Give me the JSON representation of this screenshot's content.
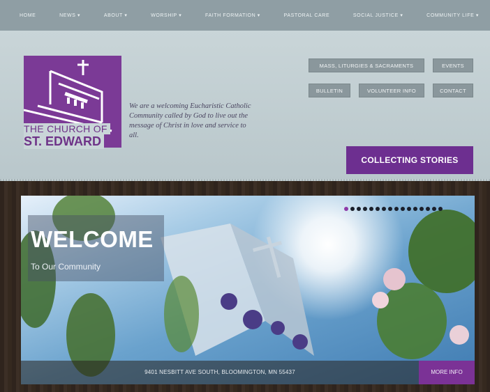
{
  "nav": {
    "items": [
      "HOME",
      "NEWS ▾",
      "ABOUT ▾",
      "WORSHIP ▾",
      "FAITH FORMATION ▾",
      "PASTORAL CARE",
      "SOCIAL JUSTICE ▾",
      "COMMUNITY LIFE ▾"
    ]
  },
  "logo": {
    "line1": "THE CHURCH OF",
    "line2": "ST. EDWARD"
  },
  "tagline": "We are a welcoming Eucharistic Catholic Community called by God to live out the message of Christ in love and service to all.",
  "header_buttons": {
    "mass": "MASS, LITURGIES & SACRAMENTS",
    "events": "EVENTS",
    "bulletin": "BULLETIN",
    "volunteer": "VOLUNTEER INFO",
    "contact": "CONTACT"
  },
  "cta": "COLLECTING STORIES",
  "slide": {
    "title": "WELCOME",
    "subtitle": "To Our Community",
    "address": "9401 NESBITT AVE SOUTH, BLOOMINGTON, MN 55437",
    "more_info": "MORE INFO",
    "active_slide": 1,
    "total_slides": 16
  },
  "colors": {
    "brand_purple": "#6d2f90",
    "nav_gray": "#8f9ea4",
    "header_bg": "#c9d5d8"
  }
}
